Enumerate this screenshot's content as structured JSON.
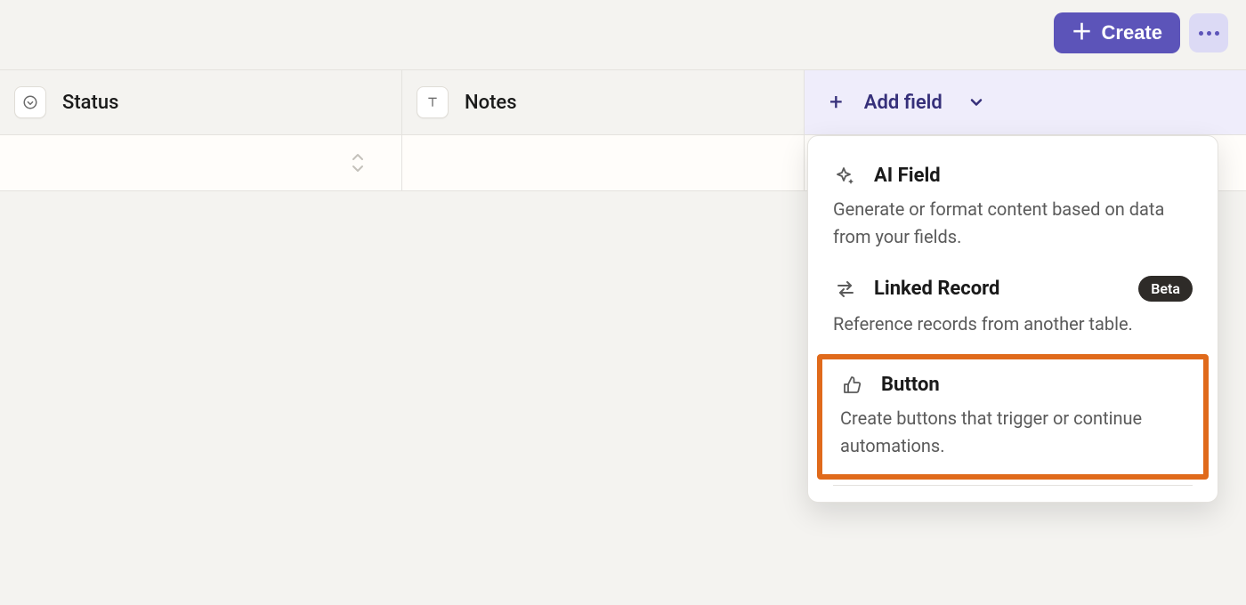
{
  "toolbar": {
    "create_label": "Create"
  },
  "columns": {
    "status": {
      "label": "Status"
    },
    "notes": {
      "label": "Notes"
    },
    "add": {
      "label": "Add field"
    }
  },
  "dropdown": {
    "items": [
      {
        "title": "AI Field",
        "desc": "Generate or format content based on data from your fields.",
        "badge": null
      },
      {
        "title": "Linked Record",
        "desc": "Reference records from another table.",
        "badge": "Beta"
      },
      {
        "title": "Button",
        "desc": "Create buttons that trigger or continue automations.",
        "badge": null
      }
    ]
  }
}
